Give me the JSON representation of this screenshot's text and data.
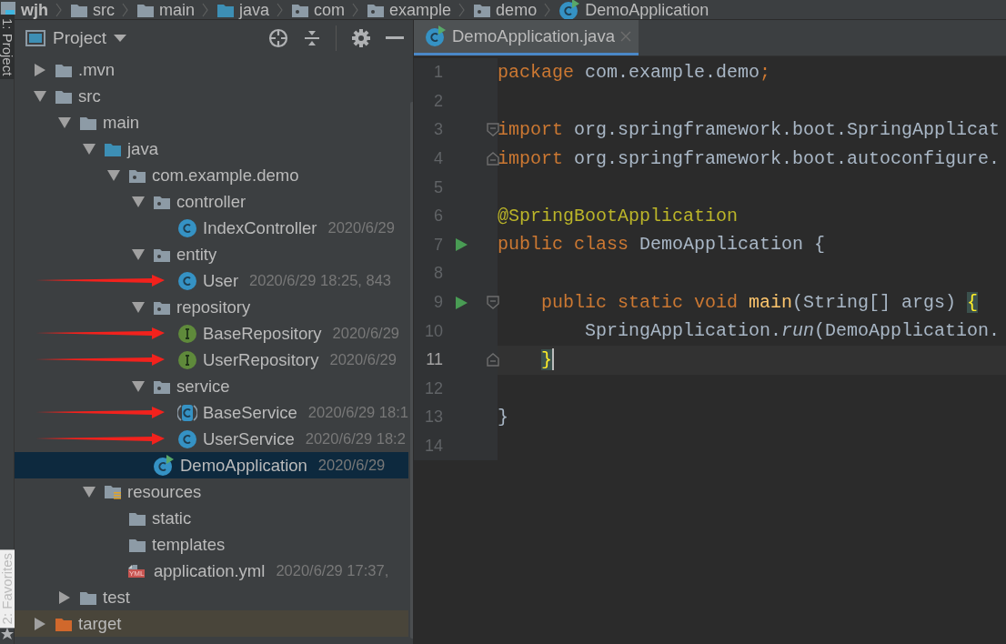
{
  "breadcrumbs": [
    {
      "label": "wjh",
      "kind": "module"
    },
    {
      "label": "src",
      "kind": "folder"
    },
    {
      "label": "main",
      "kind": "folder"
    },
    {
      "label": "java",
      "kind": "source-folder"
    },
    {
      "label": "com",
      "kind": "package"
    },
    {
      "label": "example",
      "kind": "package"
    },
    {
      "label": "demo",
      "kind": "package"
    },
    {
      "label": "DemoApplication",
      "kind": "class-run"
    }
  ],
  "side_tabs": [
    {
      "label": "1: Project",
      "selected": true
    },
    {
      "label": "2: Favorites",
      "selected": false
    }
  ],
  "project_panel": {
    "title": "Project",
    "tree": [
      {
        "name": ".mvn",
        "kind": "folder",
        "expanded": false,
        "marked": false
      },
      {
        "name": "src",
        "kind": "folder",
        "expanded": true,
        "marked": false,
        "children": [
          {
            "name": "main",
            "kind": "folder",
            "expanded": true,
            "marked": false,
            "children": [
              {
                "name": "java",
                "kind": "source-folder",
                "expanded": true,
                "marked": false,
                "children": [
                  {
                    "name": "com.example.demo",
                    "kind": "package",
                    "expanded": true,
                    "marked": false,
                    "children": [
                      {
                        "name": "controller",
                        "kind": "package",
                        "expanded": true,
                        "marked": false,
                        "children": [
                          {
                            "name": "IndexController",
                            "kind": "class",
                            "meta": "2020/6/29",
                            "marked": false,
                            "selected": false
                          }
                        ]
                      },
                      {
                        "name": "entity",
                        "kind": "package",
                        "expanded": true,
                        "marked": false,
                        "children": [
                          {
                            "name": "User",
                            "kind": "class",
                            "meta": "2020/6/29 18:25, 843",
                            "marked": true,
                            "selected": false
                          }
                        ]
                      },
                      {
                        "name": "repository",
                        "kind": "package",
                        "expanded": true,
                        "marked": false,
                        "children": [
                          {
                            "name": "BaseRepository",
                            "kind": "interface",
                            "meta": "2020/6/29",
                            "marked": true,
                            "selected": false
                          },
                          {
                            "name": "UserRepository",
                            "kind": "interface",
                            "meta": "2020/6/29",
                            "marked": true,
                            "selected": false
                          }
                        ]
                      },
                      {
                        "name": "service",
                        "kind": "package",
                        "expanded": true,
                        "marked": false,
                        "children": [
                          {
                            "name": "BaseService",
                            "kind": "abstract-class",
                            "meta": "2020/6/29 18:1",
                            "marked": true,
                            "selected": false
                          },
                          {
                            "name": "UserService",
                            "kind": "class",
                            "meta": "2020/6/29 18:2",
                            "marked": true,
                            "selected": false
                          }
                        ]
                      },
                      {
                        "name": "DemoApplication",
                        "kind": "class-run",
                        "meta": "2020/6/29",
                        "marked": false,
                        "selected": true
                      }
                    ]
                  }
                ]
              },
              {
                "name": "resources",
                "kind": "resources-folder",
                "expanded": true,
                "marked": false,
                "children": [
                  {
                    "name": "static",
                    "kind": "folder",
                    "marked": false
                  },
                  {
                    "name": "templates",
                    "kind": "folder",
                    "marked": false
                  },
                  {
                    "name": "application.yml",
                    "kind": "yml-file",
                    "badge": "YML",
                    "meta": "2020/6/29 17:37,",
                    "marked": false,
                    "selected": false
                  }
                ]
              }
            ]
          },
          {
            "name": "test",
            "kind": "folder",
            "expanded": false,
            "marked": false
          }
        ]
      },
      {
        "name": "target",
        "kind": "excluded-folder",
        "expanded": false,
        "marked": false
      }
    ]
  },
  "editor": {
    "tab": {
      "label": "DemoApplication.java",
      "selected": true
    },
    "lines": [
      {
        "number": "1",
        "tokens": [
          {
            "kind": "keyword",
            "text": "package "
          },
          {
            "kind": "plain",
            "text": "com.example.demo"
          },
          {
            "kind": "keyword",
            "text": ";"
          }
        ]
      },
      {
        "number": "2"
      },
      {
        "number": "3",
        "fold_start": true,
        "tokens": [
          {
            "kind": "keyword",
            "text": "import "
          },
          {
            "kind": "plain",
            "text": "org.springframework.boot.SpringApplicat"
          }
        ]
      },
      {
        "number": "4",
        "fold_end": true,
        "tokens": [
          {
            "kind": "keyword",
            "text": "import "
          },
          {
            "kind": "plain",
            "text": "org.springframework.boot.autoconfigure."
          }
        ]
      },
      {
        "number": "5"
      },
      {
        "number": "6",
        "tokens": [
          {
            "kind": "annotation",
            "text": "@SpringBootApplication"
          }
        ]
      },
      {
        "number": "7",
        "run": true,
        "tokens": [
          {
            "kind": "keyword",
            "text": "public class "
          },
          {
            "kind": "plain",
            "text": "DemoApplication {"
          }
        ]
      },
      {
        "number": "8"
      },
      {
        "number": "9",
        "run": true,
        "fold_start": true,
        "tokens": [
          {
            "kind": "keyword",
            "text": "    public static void "
          },
          {
            "kind": "method",
            "text": "main"
          },
          {
            "kind": "plain",
            "text": "(String[] args) "
          },
          {
            "kind": "brace-match",
            "text": "{"
          }
        ]
      },
      {
        "number": "10",
        "tokens": [
          {
            "kind": "plain",
            "text": "        SpringApplication."
          },
          {
            "kind": "static-call",
            "text": "run"
          },
          {
            "kind": "plain",
            "text": "(DemoApplication."
          }
        ]
      },
      {
        "number": "11",
        "current": true,
        "fold_end": true,
        "tokens": [
          {
            "kind": "brace-match",
            "text": "    }"
          }
        ]
      },
      {
        "number": "12"
      },
      {
        "number": "13",
        "tokens": [
          {
            "kind": "plain",
            "text": "}"
          }
        ]
      },
      {
        "number": "14"
      }
    ]
  }
}
